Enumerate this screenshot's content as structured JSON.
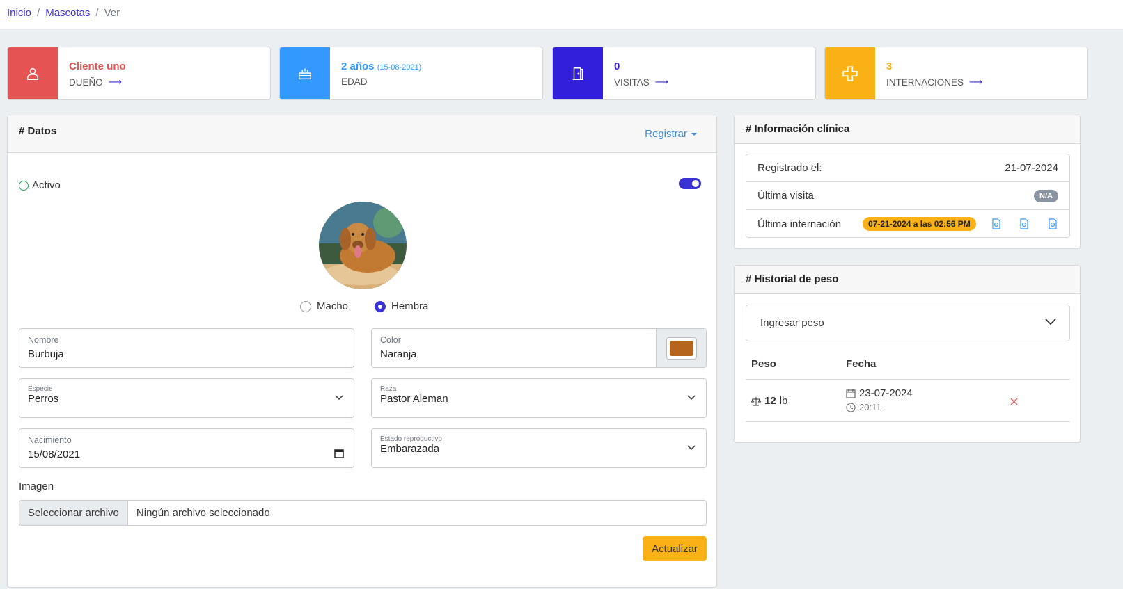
{
  "breadcrumb": {
    "home": "Inicio",
    "section": "Mascotas",
    "current": "Ver",
    "sep": "/"
  },
  "stats": [
    {
      "value": "Cliente uno",
      "extra": "",
      "label": "DUEÑO",
      "color": "#e55353",
      "icon": "user-icon"
    },
    {
      "value": "2 años",
      "extra": "(15-08-2021)",
      "label": "EDAD",
      "color": "#3399ff",
      "icon": "cake-icon"
    },
    {
      "value": "0",
      "extra": "",
      "label": "VISITAS",
      "color": "#321fdb",
      "icon": "door-icon"
    },
    {
      "value": "3",
      "extra": "",
      "label": "INTERNACIONES",
      "color": "#f9b115",
      "icon": "plus-icon"
    }
  ],
  "datos": {
    "title": "# Datos",
    "registrar": "Registrar",
    "activo": "Activo",
    "gender": {
      "male": "Macho",
      "female": "Hembra",
      "selected": "female"
    },
    "nombre": {
      "label": "Nombre",
      "value": "Burbuja"
    },
    "color": {
      "label": "Color",
      "value": "Naranja",
      "swatch": "#b5651d"
    },
    "especie": {
      "label": "Especie",
      "value": "Perros"
    },
    "raza": {
      "label": "Raza",
      "value": "Pastor Aleman"
    },
    "nacimiento": {
      "label": "Nacimiento",
      "value": "15/08/2021"
    },
    "estado": {
      "label": "Estado reproductivo",
      "value": "Embarazada"
    },
    "imagen_label": "Imagen",
    "file_button": "Seleccionar archivo",
    "file_name": "Ningún archivo seleccionado",
    "submit": "Actualizar"
  },
  "clinica": {
    "title": "# Información clínica",
    "rows": [
      {
        "label": "Registrado el:",
        "value": "21-07-2024"
      },
      {
        "label": "Última visita",
        "value": "N/A"
      },
      {
        "label": "Última internación",
        "value": "07-21-2024 a las 02:56 PM"
      }
    ]
  },
  "peso": {
    "title": "# Historial de peso",
    "ingresar": "Ingresar peso",
    "col_peso": "Peso",
    "col_fecha": "Fecha",
    "rows": [
      {
        "peso": "12",
        "unit": "lb",
        "fecha": "23-07-2024",
        "hora": "20:11"
      }
    ]
  }
}
